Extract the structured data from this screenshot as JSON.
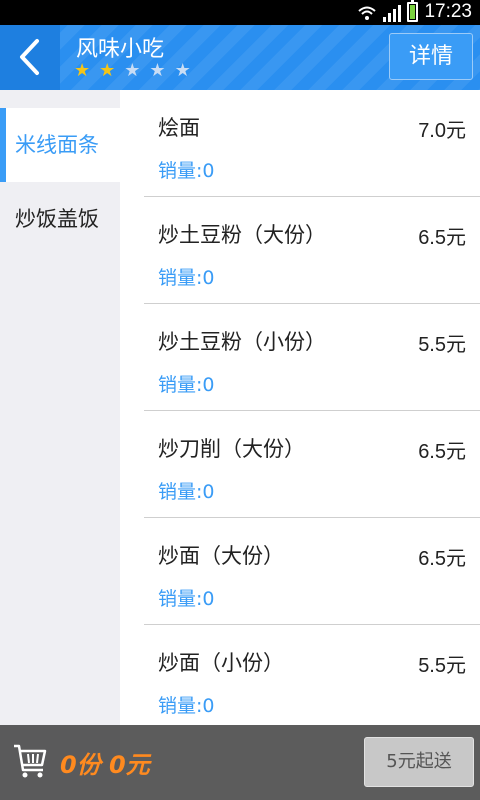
{
  "status_bar": {
    "time": "17:23"
  },
  "header": {
    "title": "风味小吃",
    "rating": {
      "filled": 2,
      "total": 5
    },
    "detail_label": "详情"
  },
  "sidebar": {
    "categories": [
      {
        "label": "米线面条",
        "active": true
      },
      {
        "label": "炒饭盖饭",
        "active": false
      }
    ]
  },
  "dishes": [
    {
      "name": "烩面",
      "price": "7.0元",
      "sales": "销量:0"
    },
    {
      "name": "炒土豆粉（大份）",
      "price": "6.5元",
      "sales": "销量:0"
    },
    {
      "name": "炒土豆粉（小份）",
      "price": "5.5元",
      "sales": "销量:0"
    },
    {
      "name": "炒刀削（大份）",
      "price": "6.5元",
      "sales": "销量:0"
    },
    {
      "name": "炒面（大份）",
      "price": "6.5元",
      "sales": "销量:0"
    },
    {
      "name": "炒面（小份）",
      "price": "5.5元",
      "sales": "销量:0"
    }
  ],
  "cart": {
    "summary": "0份 0元",
    "checkout_label": "5元起送"
  },
  "colors": {
    "accent": "#3a9cf6",
    "header": "#2a8ff0",
    "star_on": "#f5c518",
    "cart_total": "#ff8a1f"
  }
}
